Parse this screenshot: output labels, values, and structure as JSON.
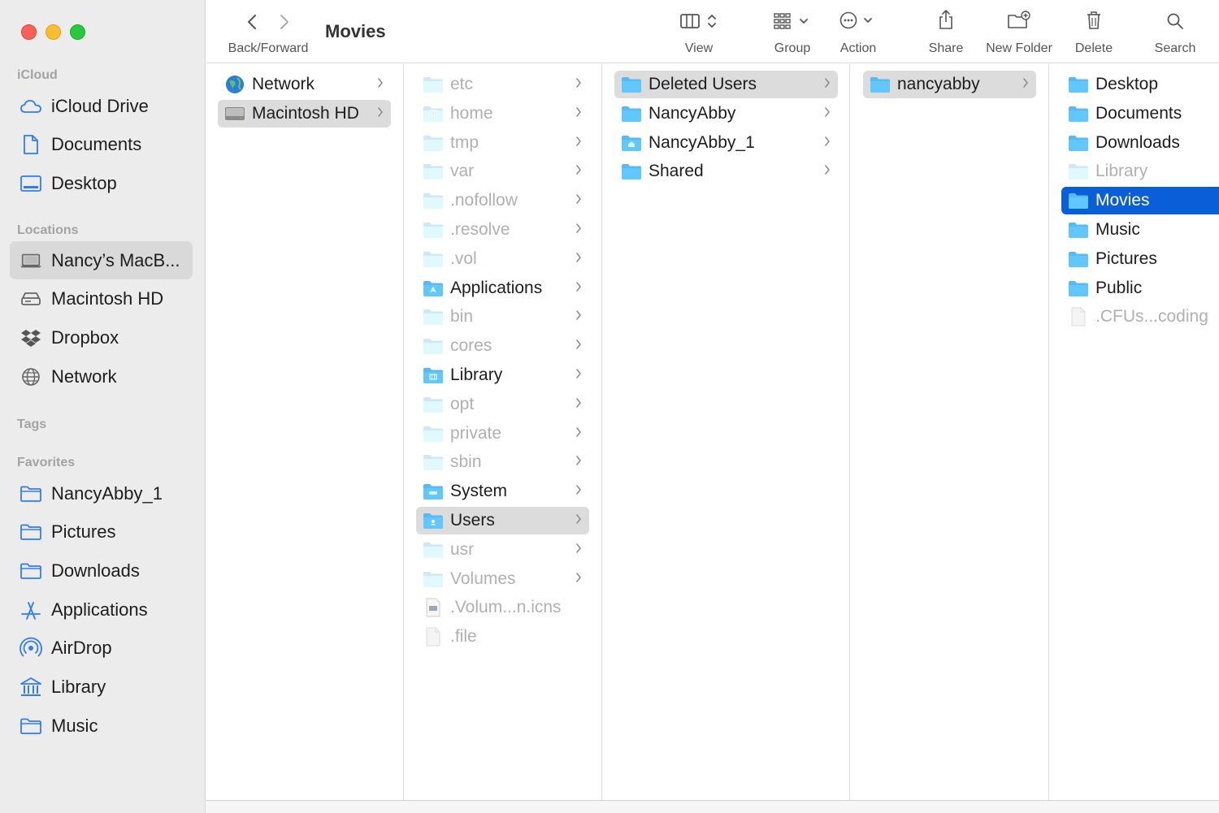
{
  "window": {
    "title": "Movies"
  },
  "toolbar": {
    "back_forward_label": "Back/Forward",
    "view_label": "View",
    "group_label": "Group",
    "action_label": "Action",
    "share_label": "Share",
    "new_folder_label": "New Folder",
    "delete_label": "Delete",
    "search_label": "Search"
  },
  "sidebar": {
    "icloud_header": "iCloud",
    "icloud_items": [
      {
        "label": "iCloud Drive",
        "icon": "cloud-icon"
      },
      {
        "label": "Documents",
        "icon": "document-icon"
      },
      {
        "label": "Desktop",
        "icon": "desktop-icon"
      }
    ],
    "locations_header": "Locations",
    "location_items": [
      {
        "label": "Nancy’s MacB...",
        "icon": "laptop-icon",
        "selected": true
      },
      {
        "label": "Macintosh HD",
        "icon": "disk-icon"
      },
      {
        "label": "Dropbox",
        "icon": "dropbox-icon"
      },
      {
        "label": "Network",
        "icon": "globe-icon"
      }
    ],
    "tags_header": "Tags",
    "favorites_header": "Favorites",
    "favorite_items": [
      {
        "label": "NancyAbby_1",
        "icon": "folder-icon"
      },
      {
        "label": "Pictures",
        "icon": "folder-icon"
      },
      {
        "label": "Downloads",
        "icon": "folder-icon"
      },
      {
        "label": "Applications",
        "icon": "applications-icon"
      },
      {
        "label": "AirDrop",
        "icon": "airdrop-icon"
      },
      {
        "label": "Library",
        "icon": "library-icon"
      },
      {
        "label": "Music",
        "icon": "folder-icon"
      }
    ]
  },
  "columns": [
    {
      "items": [
        {
          "label": "Network",
          "icon": "network-globe-icon",
          "chevron": true
        },
        {
          "label": "Macintosh HD",
          "icon": "hard-drive-icon",
          "chevron": true,
          "selected": "gray"
        }
      ]
    },
    {
      "items": [
        {
          "label": "etc",
          "icon": "folder-icon",
          "chevron": true,
          "dim": true
        },
        {
          "label": "home",
          "icon": "home-folder-icon",
          "chevron": true,
          "dim": true
        },
        {
          "label": "tmp",
          "icon": "folder-icon",
          "chevron": true,
          "dim": true
        },
        {
          "label": "var",
          "icon": "folder-icon",
          "chevron": true,
          "dim": true
        },
        {
          "label": ".nofollow",
          "icon": "folder-icon",
          "chevron": true,
          "dim": true
        },
        {
          "label": ".resolve",
          "icon": "folder-icon",
          "chevron": true,
          "dim": true
        },
        {
          "label": ".vol",
          "icon": "folder-icon",
          "chevron": true,
          "dim": true
        },
        {
          "label": "Applications",
          "icon": "applications-folder-icon",
          "chevron": true
        },
        {
          "label": "bin",
          "icon": "folder-icon",
          "chevron": true,
          "dim": true
        },
        {
          "label": "cores",
          "icon": "folder-icon",
          "chevron": true,
          "dim": true
        },
        {
          "label": "Library",
          "icon": "library-folder-icon",
          "chevron": true
        },
        {
          "label": "opt",
          "icon": "folder-icon",
          "chevron": true,
          "dim": true
        },
        {
          "label": "private",
          "icon": "folder-icon",
          "chevron": true,
          "dim": true
        },
        {
          "label": "sbin",
          "icon": "folder-icon",
          "chevron": true,
          "dim": true
        },
        {
          "label": "System",
          "icon": "system-folder-icon",
          "chevron": true
        },
        {
          "label": "Users",
          "icon": "users-folder-icon",
          "chevron": true,
          "selected": "gray"
        },
        {
          "label": "usr",
          "icon": "folder-icon",
          "chevron": true,
          "dim": true
        },
        {
          "label": "Volumes",
          "icon": "folder-icon",
          "chevron": true,
          "dim": true
        },
        {
          "label": ".Volum...n.icns",
          "icon": "icns-file-icon",
          "chevron": false,
          "dim": true
        },
        {
          "label": ".file",
          "icon": "file-icon",
          "chevron": false,
          "dim": true
        }
      ]
    },
    {
      "items": [
        {
          "label": "Deleted Users",
          "icon": "folder-icon",
          "chevron": true,
          "selected": "gray"
        },
        {
          "label": "NancyAbby",
          "icon": "folder-icon",
          "chevron": true
        },
        {
          "label": "NancyAbby_1",
          "icon": "home-folder-icon",
          "chevron": true
        },
        {
          "label": "Shared",
          "icon": "folder-icon",
          "chevron": true
        }
      ]
    },
    {
      "items": [
        {
          "label": "nancyabby",
          "icon": "folder-icon",
          "chevron": true,
          "selected": "gray"
        }
      ]
    },
    {
      "items": [
        {
          "label": "Desktop",
          "icon": "folder-icon",
          "chevron": false
        },
        {
          "label": "Documents",
          "icon": "folder-icon",
          "chevron": false
        },
        {
          "label": "Downloads",
          "icon": "folder-icon",
          "chevron": false
        },
        {
          "label": "Library",
          "icon": "folder-icon",
          "chevron": false,
          "dim": true
        },
        {
          "label": "Movies",
          "icon": "folder-icon",
          "chevron": false,
          "selected": "blue"
        },
        {
          "label": "Music",
          "icon": "folder-icon",
          "chevron": false
        },
        {
          "label": "Pictures",
          "icon": "folder-icon",
          "chevron": false
        },
        {
          "label": "Public",
          "icon": "folder-icon",
          "chevron": false
        },
        {
          "label": ".CFUs...coding",
          "icon": "file-icon",
          "chevron": false,
          "dim": true
        }
      ]
    }
  ],
  "colors": {
    "accent": "#0a5fd9",
    "folder": "#5ab9f1",
    "sidebar_icon": "#2f7cf6"
  }
}
